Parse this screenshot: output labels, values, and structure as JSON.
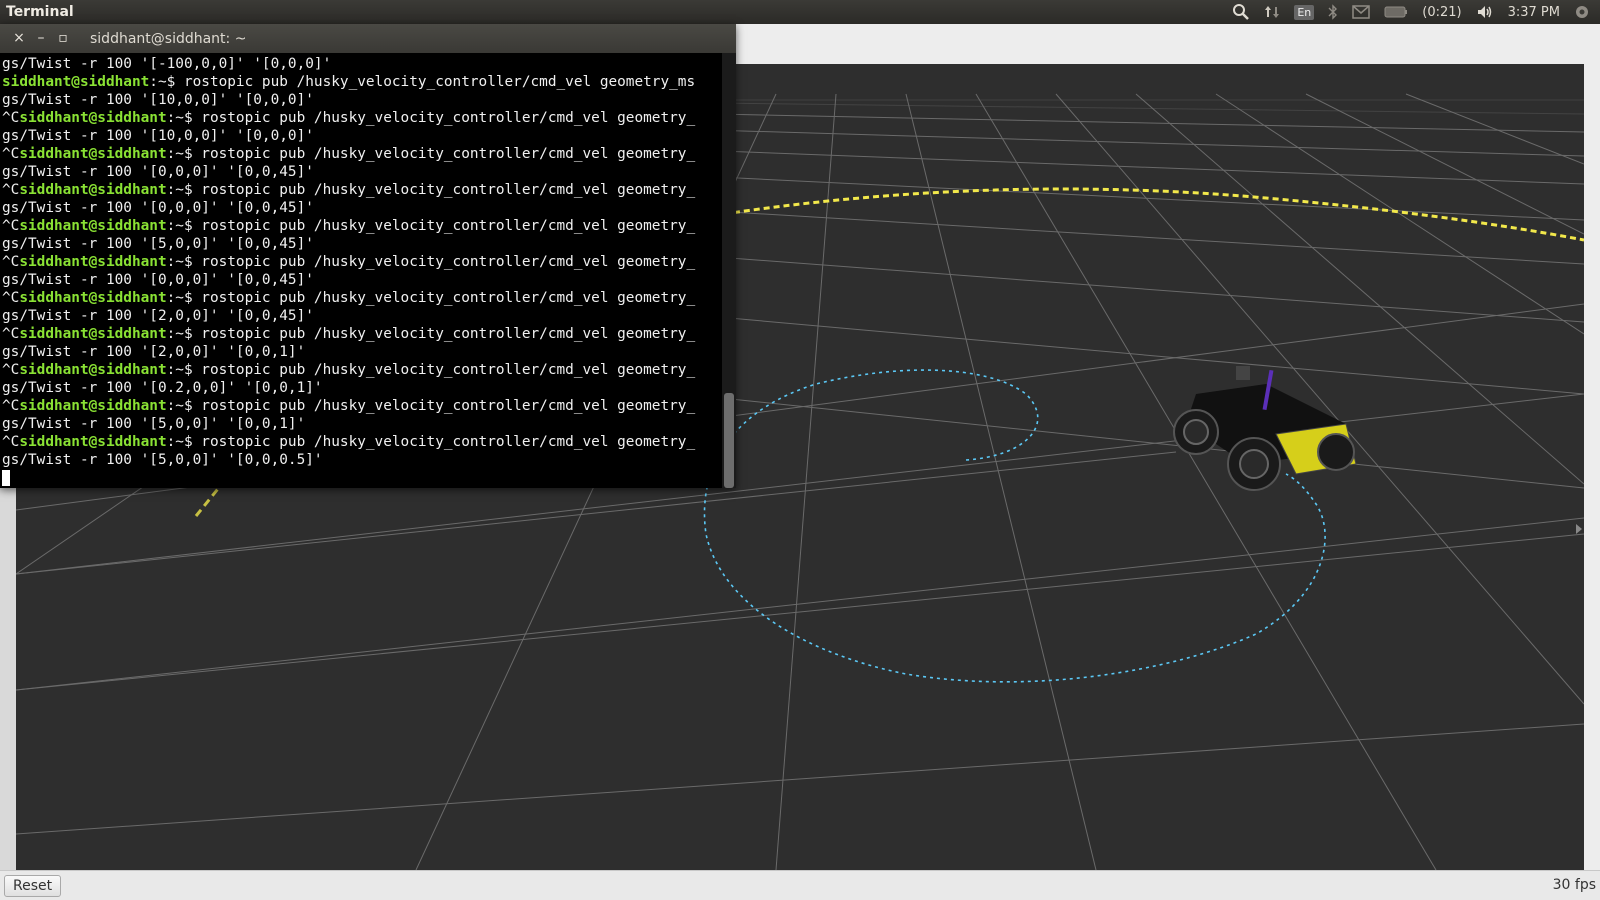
{
  "topbar": {
    "app_title": "Terminal",
    "indicators": {
      "search_icon": "search-icon",
      "network_icon": "network-arrows-icon",
      "keyboard_layout": "En",
      "bluetooth_icon": "bluetooth-icon",
      "mail_icon": "mail-icon",
      "battery_icon": "battery-icon",
      "battery_time": "(0:21)",
      "volume_icon": "volume-icon",
      "clock": "3:37 PM",
      "power_icon": "gear-power-icon"
    }
  },
  "terminal": {
    "title": "siddhant@siddhant: ~",
    "buttons": {
      "close": "×",
      "minimize": "–",
      "maximize": "▫"
    },
    "lines": [
      {
        "prefix": "",
        "prompt": "",
        "text": "gs/Twist -r 100 '[-100,0,0]' '[0,0,0]'"
      },
      {
        "prefix": "",
        "prompt": "siddhant@siddhant",
        "text": ":~$ rostopic pub /husky_velocity_controller/cmd_vel geometry_ms"
      },
      {
        "prefix": "",
        "prompt": "",
        "text": "gs/Twist -r 100 '[10,0,0]' '[0,0,0]'"
      },
      {
        "prefix": "^C",
        "prompt": "siddhant@siddhant",
        "text": ":~$ rostopic pub /husky_velocity_controller/cmd_vel geometry_"
      },
      {
        "prefix": "",
        "prompt": "",
        "text": "gs/Twist -r 100 '[10,0,0]' '[0,0,0]'"
      },
      {
        "prefix": "^C",
        "prompt": "siddhant@siddhant",
        "text": ":~$ rostopic pub /husky_velocity_controller/cmd_vel geometry_"
      },
      {
        "prefix": "",
        "prompt": "",
        "text": "gs/Twist -r 100 '[0,0,0]' '[0,0,45]'"
      },
      {
        "prefix": "^C",
        "prompt": "siddhant@siddhant",
        "text": ":~$ rostopic pub /husky_velocity_controller/cmd_vel geometry_"
      },
      {
        "prefix": "",
        "prompt": "",
        "text": "gs/Twist -r 100 '[0,0,0]' '[0,0,45]'"
      },
      {
        "prefix": "^C",
        "prompt": "siddhant@siddhant",
        "text": ":~$ rostopic pub /husky_velocity_controller/cmd_vel geometry_"
      },
      {
        "prefix": "",
        "prompt": "",
        "text": "gs/Twist -r 100 '[5,0,0]' '[0,0,45]'"
      },
      {
        "prefix": "^C",
        "prompt": "siddhant@siddhant",
        "text": ":~$ rostopic pub /husky_velocity_controller/cmd_vel geometry_"
      },
      {
        "prefix": "",
        "prompt": "",
        "text": "gs/Twist -r 100 '[0,0,0]' '[0,0,45]'"
      },
      {
        "prefix": "^C",
        "prompt": "siddhant@siddhant",
        "text": ":~$ rostopic pub /husky_velocity_controller/cmd_vel geometry_"
      },
      {
        "prefix": "",
        "prompt": "",
        "text": "gs/Twist -r 100 '[2,0,0]' '[0,0,45]'"
      },
      {
        "prefix": "^C",
        "prompt": "siddhant@siddhant",
        "text": ":~$ rostopic pub /husky_velocity_controller/cmd_vel geometry_"
      },
      {
        "prefix": "",
        "prompt": "",
        "text": "gs/Twist -r 100 '[2,0,0]' '[0,0,1]'"
      },
      {
        "prefix": "^C",
        "prompt": "siddhant@siddhant",
        "text": ":~$ rostopic pub /husky_velocity_controller/cmd_vel geometry_"
      },
      {
        "prefix": "",
        "prompt": "",
        "text": "gs/Twist -r 100 '[0.2,0,0]' '[0,0,1]'"
      },
      {
        "prefix": "^C",
        "prompt": "siddhant@siddhant",
        "text": ":~$ rostopic pub /husky_velocity_controller/cmd_vel geometry_"
      },
      {
        "prefix": "",
        "prompt": "",
        "text": "gs/Twist -r 100 '[5,0,0]' '[0,0,1]'"
      },
      {
        "prefix": "^C",
        "prompt": "siddhant@siddhant",
        "text": ":~$ rostopic pub /husky_velocity_controller/cmd_vel geometry_"
      },
      {
        "prefix": "",
        "prompt": "",
        "text": "gs/Twist -r 100 '[5,0,0]' '[0,0,0.5]'"
      }
    ]
  },
  "bottombar": {
    "reset_label": "Reset",
    "fps": "30 fps"
  },
  "colors": {
    "prompt": "#8ae234",
    "grid_bg": "#2e2e2e",
    "grid_line": "#6a6a6a",
    "path_blue": "#5bc8f5",
    "path_yellow": "#f2e84b",
    "robot_body": "#111111",
    "robot_plate": "#d6cf1a"
  }
}
